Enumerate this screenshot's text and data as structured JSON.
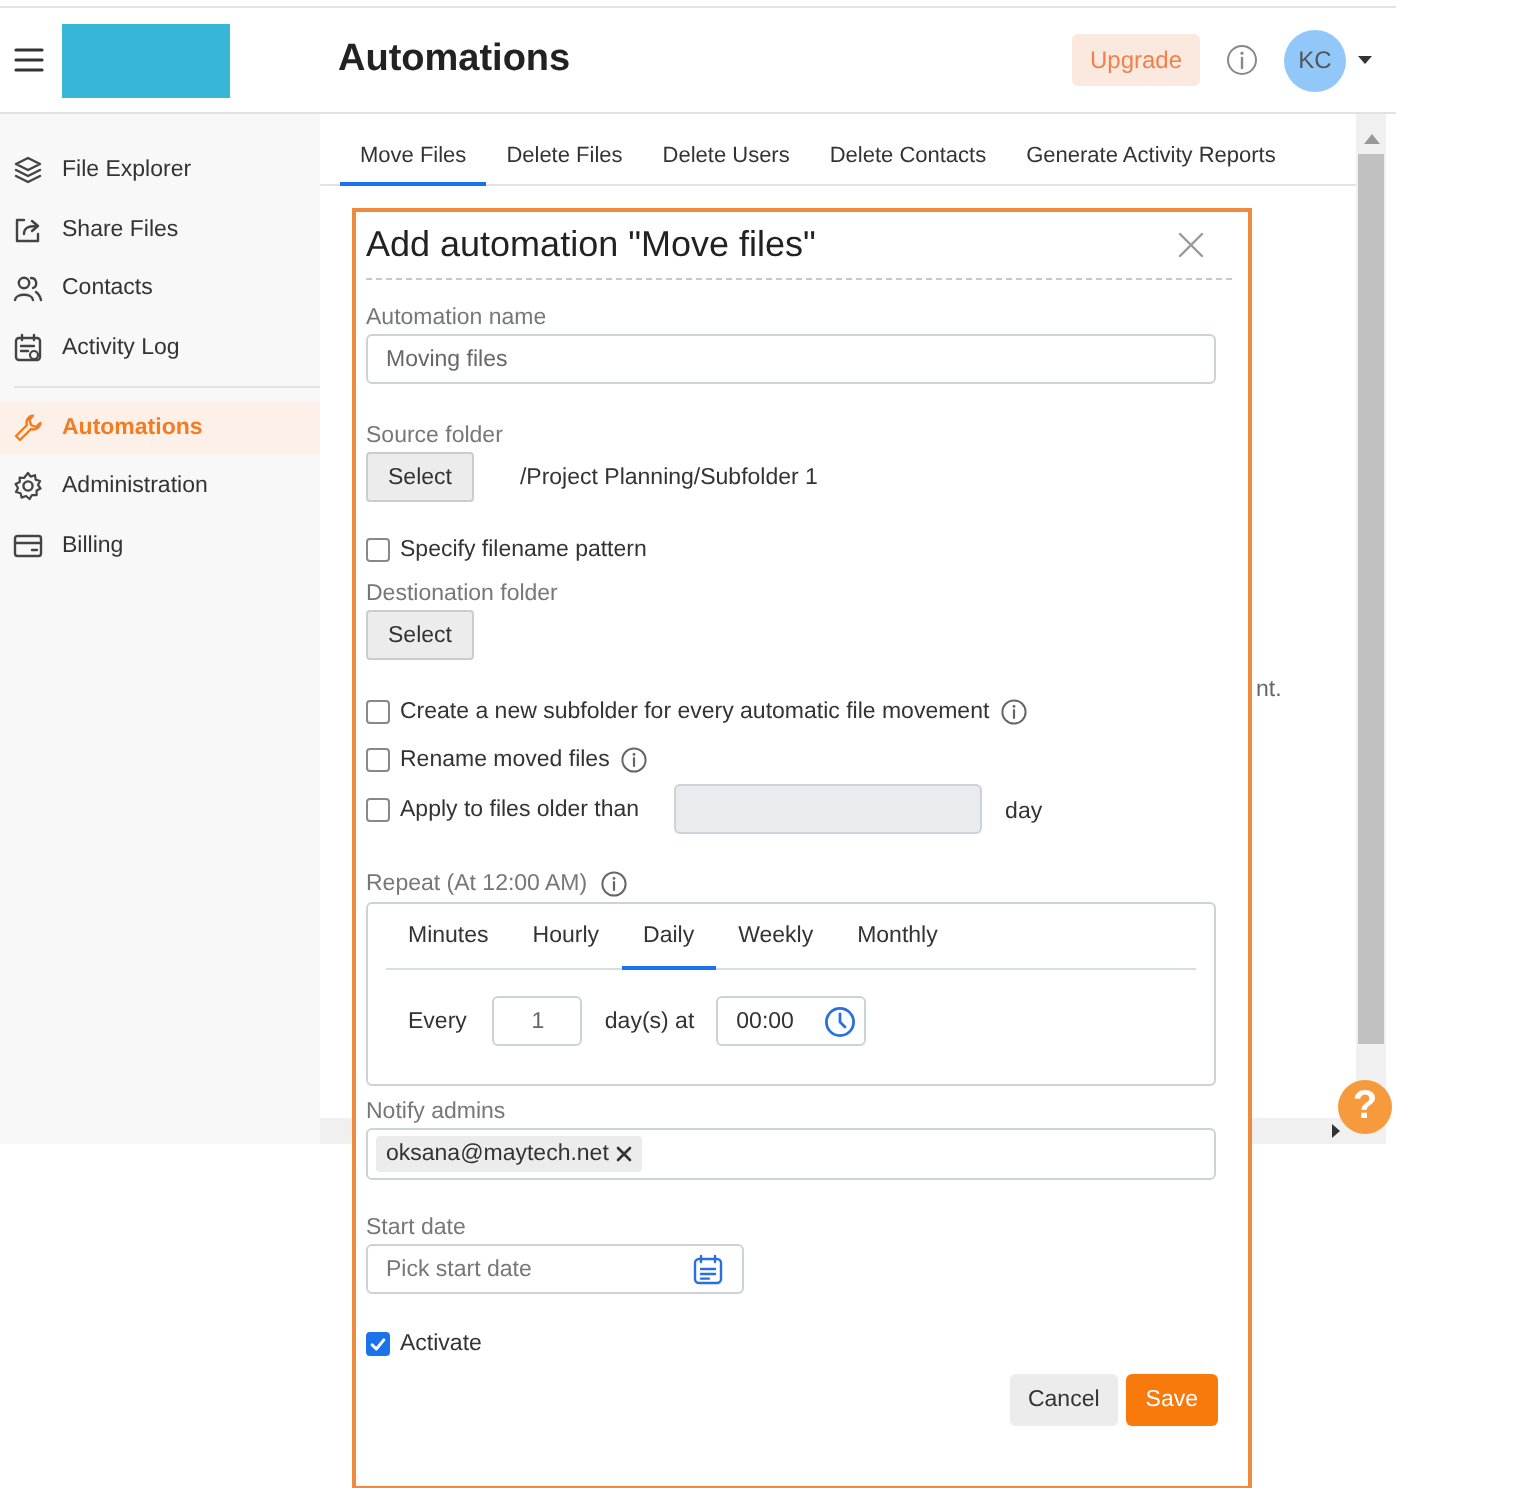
{
  "header": {
    "title": "Automations",
    "upgrade": "Upgrade",
    "avatar": "KC"
  },
  "sidebar": {
    "groups": [
      [
        {
          "label": "File Explorer",
          "selected": false
        },
        {
          "label": "Share Files",
          "selected": false
        },
        {
          "label": "Contacts",
          "selected": false
        },
        {
          "label": "Activity Log",
          "selected": false
        }
      ],
      [
        {
          "label": "Automations",
          "selected": true
        },
        {
          "label": "Administration",
          "selected": false
        },
        {
          "label": "Billing",
          "selected": false
        }
      ]
    ]
  },
  "tabs": [
    {
      "label": "Move Files",
      "selected": true
    },
    {
      "label": "Delete Files",
      "selected": false
    },
    {
      "label": "Delete Users",
      "selected": false
    },
    {
      "label": "Delete Contacts",
      "selected": false
    },
    {
      "label": "Generate Activity Reports",
      "selected": false
    }
  ],
  "background_text": "nt.",
  "help": "?",
  "dialog": {
    "title": "Add automation \"Move files\"",
    "automation_name": {
      "label": "Automation name",
      "value": "Moving files"
    },
    "source_folder": {
      "label": "Source folder",
      "button": "Select",
      "path": "/Project Planning/Subfolder 1"
    },
    "filename_pattern": {
      "label": "Specify filename pattern",
      "checked": false
    },
    "destination_folder": {
      "label": "Destionation folder",
      "button": "Select"
    },
    "options": [
      {
        "kind": "info",
        "label": "Create a new subfolder for every automatic file movement",
        "checked": false
      },
      {
        "kind": "info",
        "label": "Rename moved files",
        "checked": false
      },
      {
        "kind": "days",
        "label": "Apply to files older than",
        "checked": false,
        "disabled": true,
        "unit": "day"
      }
    ],
    "repeat": {
      "label": "Repeat (At 12:00 AM)",
      "tabs": [
        {
          "label": "Minutes",
          "selected": false
        },
        {
          "label": "Hourly",
          "selected": false
        },
        {
          "label": "Daily",
          "selected": true
        },
        {
          "label": "Weekly",
          "selected": false
        },
        {
          "label": "Monthly",
          "selected": false
        }
      ],
      "every": "Every",
      "count": "1",
      "unit": "day(s) at",
      "time": "00:00"
    },
    "notify": {
      "label": "Notify admins",
      "chips": [
        "oksana@maytech.net"
      ]
    },
    "start_date": {
      "label": "Start date",
      "placeholder": "Pick start date"
    },
    "activate": {
      "label": "Activate",
      "checked": true
    },
    "buttons": {
      "cancel": "Cancel",
      "save": "Save"
    }
  }
}
